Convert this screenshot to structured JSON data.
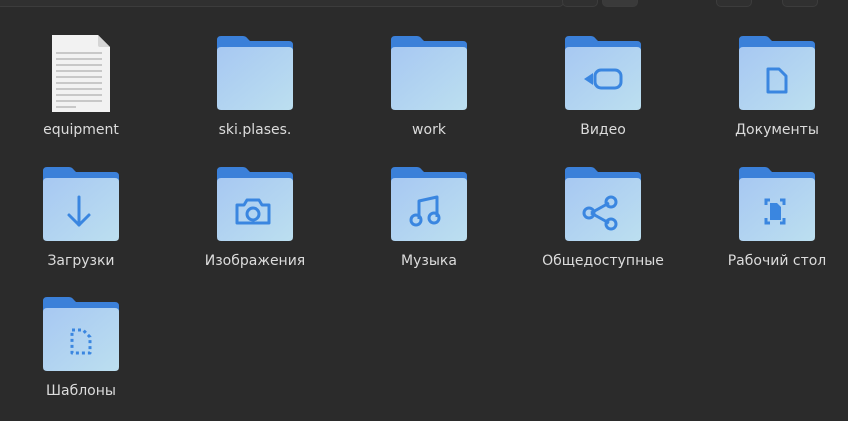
{
  "colors": {
    "background": "#2b2b2b",
    "folder_back": "#3b80d9",
    "folder_front_top": "#a7c8f2",
    "folder_front_bottom": "#bcdff0",
    "folder_glyph": "#3a86e0",
    "label_text": "#dcdcdc"
  },
  "items": [
    {
      "label": "equipment",
      "kind": "file",
      "icon": "text-document-icon"
    },
    {
      "label": "ski.plases.",
      "kind": "folder",
      "icon": "folder-icon"
    },
    {
      "label": "work",
      "kind": "folder",
      "icon": "folder-icon"
    },
    {
      "label": "Видео",
      "kind": "folder",
      "icon": "videos-folder-icon"
    },
    {
      "label": "Документы",
      "kind": "folder",
      "icon": "documents-folder-icon"
    },
    {
      "label": "Загрузки",
      "kind": "folder",
      "icon": "downloads-folder-icon"
    },
    {
      "label": "Изображения",
      "kind": "folder",
      "icon": "pictures-folder-icon"
    },
    {
      "label": "Музыка",
      "kind": "folder",
      "icon": "music-folder-icon"
    },
    {
      "label": "Общедоступные",
      "kind": "folder",
      "icon": "public-share-folder-icon"
    },
    {
      "label": "Рабочий стол",
      "kind": "folder",
      "icon": "desktop-folder-icon"
    },
    {
      "label": "Шаблоны",
      "kind": "folder",
      "icon": "templates-folder-icon"
    }
  ]
}
